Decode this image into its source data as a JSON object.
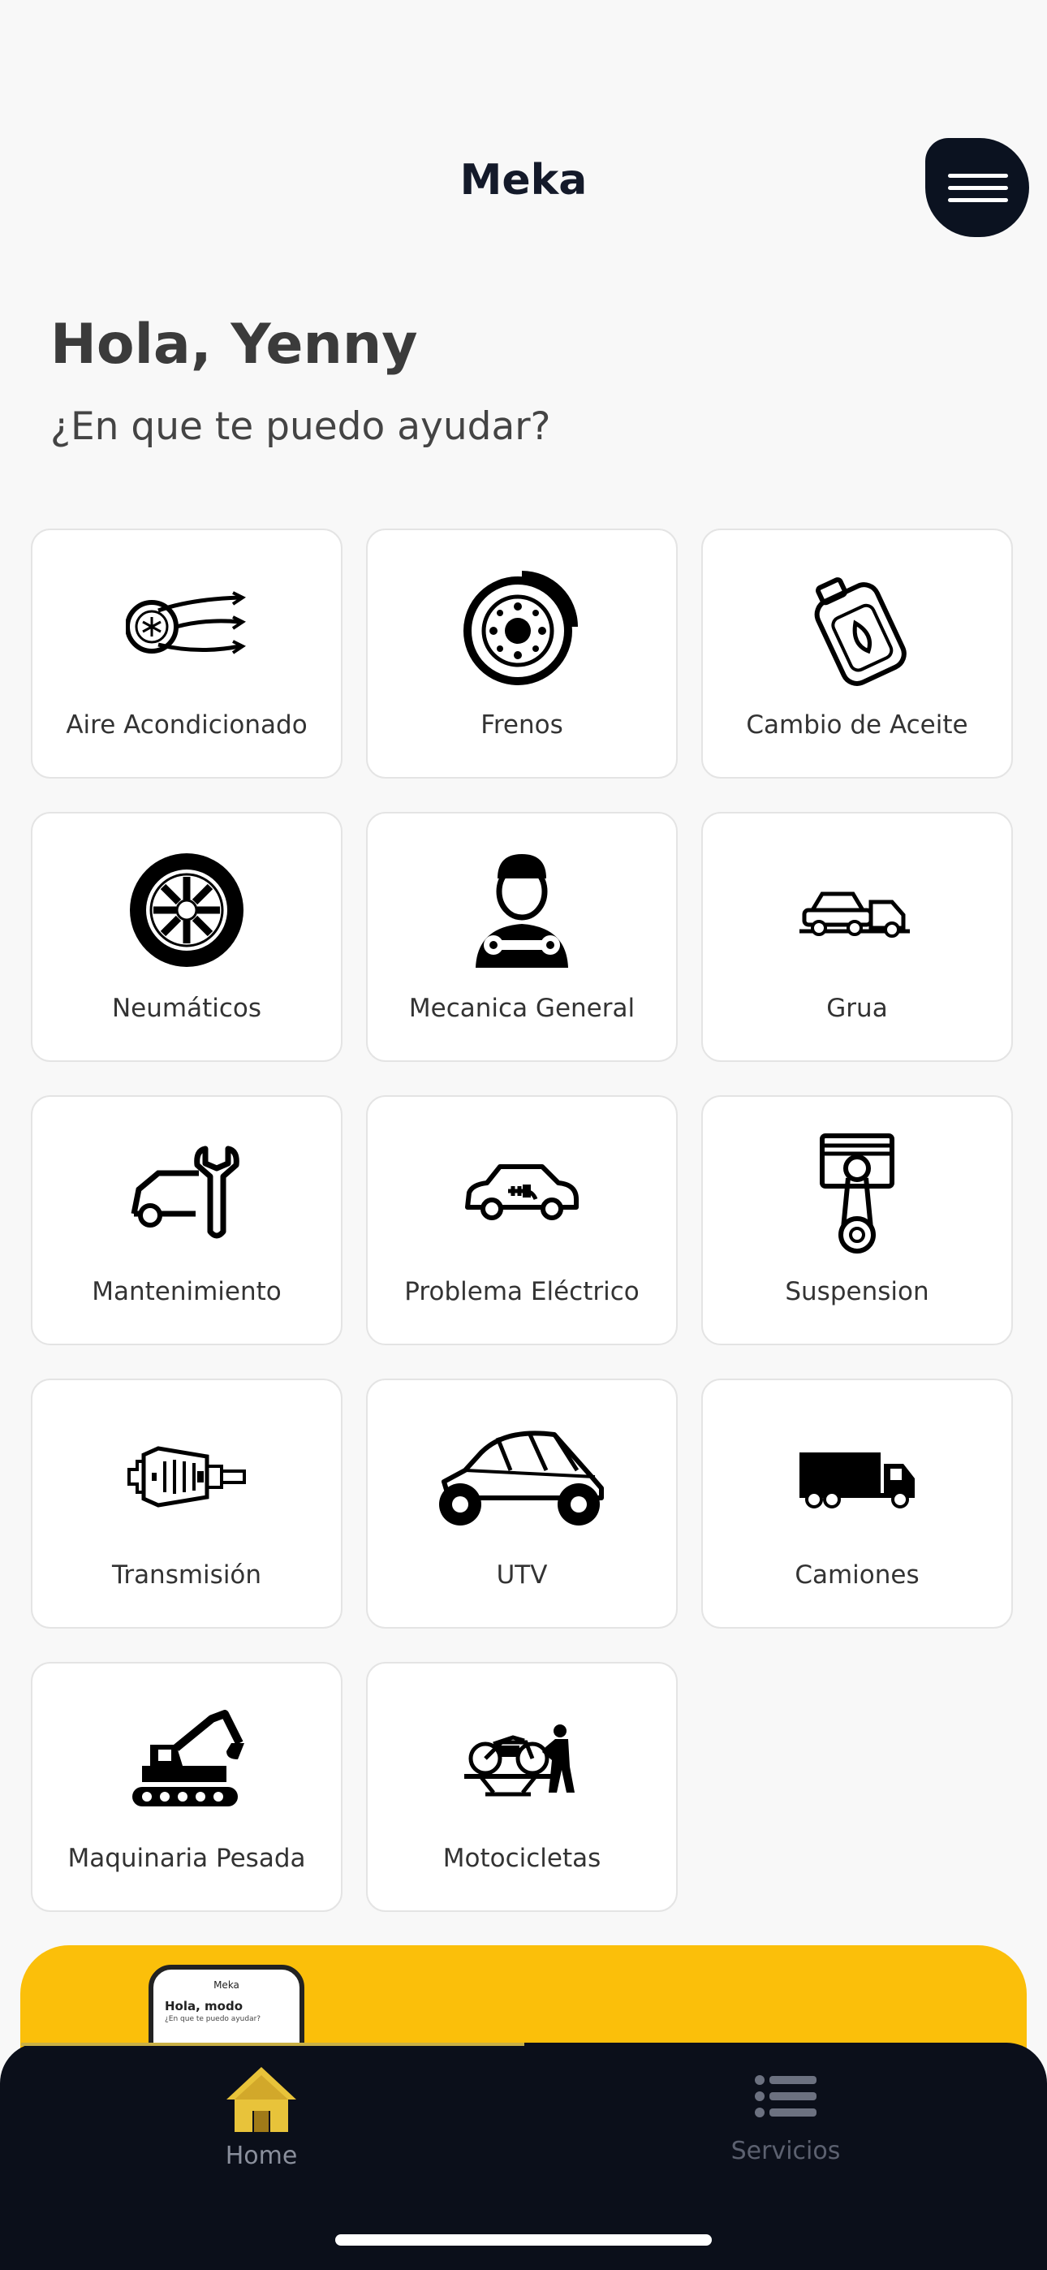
{
  "header": {
    "title": "Meka",
    "menu_icon": "hamburger-menu-icon"
  },
  "greeting": {
    "title": "Hola, Yenny",
    "subtitle": "¿En que te puedo ayudar?"
  },
  "services": [
    {
      "label": "Aire Acondicionado",
      "icon": "air-conditioning-icon"
    },
    {
      "label": "Frenos",
      "icon": "brake-disc-icon"
    },
    {
      "label": "Cambio de Aceite",
      "icon": "oil-can-icon"
    },
    {
      "label": "Neumáticos",
      "icon": "tire-icon"
    },
    {
      "label": "Mecanica General",
      "icon": "mechanic-icon"
    },
    {
      "label": "Grua",
      "icon": "tow-truck-icon"
    },
    {
      "label": "Mantenimiento",
      "icon": "car-wrench-icon"
    },
    {
      "label": "Problema Eléctrico",
      "icon": "electric-car-icon"
    },
    {
      "label": "Suspension",
      "icon": "piston-icon"
    },
    {
      "label": "Transmisión",
      "icon": "transmission-icon"
    },
    {
      "label": "UTV",
      "icon": "utv-icon"
    },
    {
      "label": "Camiones",
      "icon": "truck-icon"
    },
    {
      "label": "Maquinaria Pesada",
      "icon": "excavator-icon"
    },
    {
      "label": "Motocicletas",
      "icon": "motorcycle-icon"
    }
  ],
  "banner": {
    "phone_title": "Meka",
    "phone_greeting": "Hola, modo",
    "phone_sub": "¿En que te puedo ayudar?",
    "color": "#fbbf0a"
  },
  "bottom_nav": {
    "items": [
      {
        "label": "Home",
        "icon": "home-icon",
        "active": true
      },
      {
        "label": "Servicios",
        "icon": "list-icon",
        "active": false
      }
    ],
    "accent": "#e8c33a"
  }
}
